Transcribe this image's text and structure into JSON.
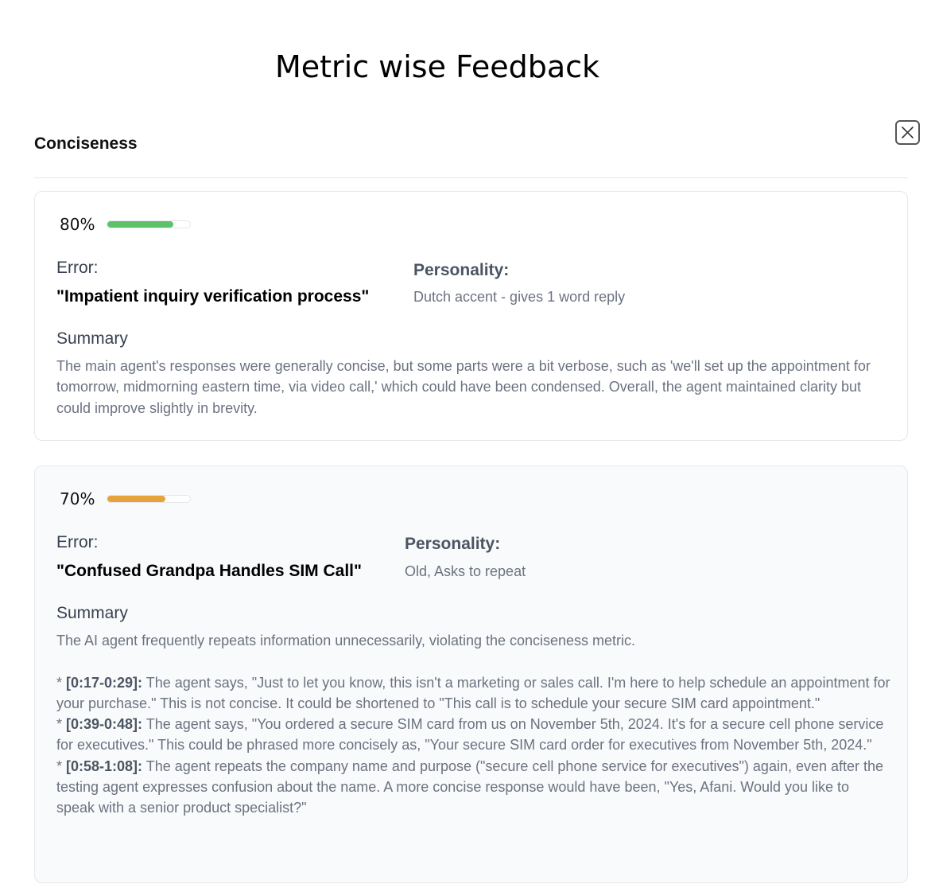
{
  "page": {
    "title": "Metric wise Feedback",
    "close_icon": "close-icon"
  },
  "metric": {
    "name": "Conciseness"
  },
  "labels": {
    "error": "Error:",
    "personality": "Personality:",
    "summary": "Summary"
  },
  "cards": [
    {
      "score_label": "80%",
      "score_fraction": 0.8,
      "bar_color": "#5cc26a",
      "error_title": "\"Impatient inquiry verification process\"",
      "personality": "Dutch accent - gives 1 word reply",
      "summary": "The main agent's responses were generally concise, but some parts were a bit verbose, such as 'we'll set up the appointment for tomorrow, midmorning eastern time, via video call,' which could have been condensed. Overall, the agent maintained clarity but could improve slightly in brevity."
    },
    {
      "score_label": "70%",
      "score_fraction": 0.7,
      "bar_color": "#e8a23b",
      "error_title": "\"Confused Grandpa Handles SIM Call\"",
      "personality": "Old, Asks to repeat",
      "summary_intro": "The AI agent frequently repeats information unnecessarily, violating the conciseness metric.",
      "summary_points": [
        {
          "time": "[0:17-0:29]:",
          "text": " The agent says, \"Just to let you know, this isn't a marketing or sales call. I'm here to help schedule an appointment for your purchase.\" This is not concise. It could be shortened to \"This call is to schedule your secure SIM card appointment.\""
        },
        {
          "time": "[0:39-0:48]:",
          "text": " The agent says, \"You ordered a secure SIM card from us on November 5th, 2024. It's for a secure cell phone service for executives.\" This could be phrased more concisely as, \"Your secure SIM card order for executives from November 5th, 2024.\""
        },
        {
          "time": "[0:58-1:08]:",
          "text": " The agent repeats the company name and purpose (\"secure cell phone service for executives\") again, even after the testing agent expresses confusion about the name. A more concise response would have been, \"Yes, Afani. Would you like to speak with a senior product specialist?\""
        }
      ]
    }
  ]
}
